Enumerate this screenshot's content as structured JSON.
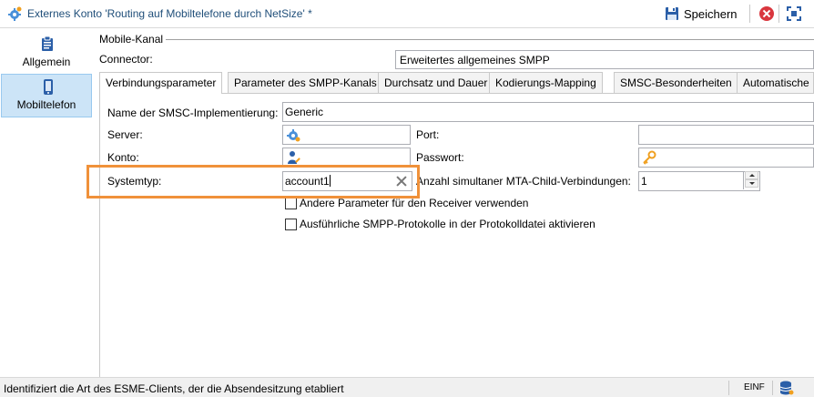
{
  "window": {
    "title": "Externes Konto 'Routing auf Mobiltelefone durch NetSize' *",
    "save_label": "Speichern",
    "icons": [
      "account-gear-icon",
      "save-disk-icon",
      "close-icon",
      "maximize-icon"
    ],
    "accent_color": "#1f4e79"
  },
  "sidebar": {
    "items": [
      {
        "label": "Allgemein",
        "icon": "clipboard-icon",
        "active": false
      },
      {
        "label": "Mobiltelefon",
        "icon": "mobile-phone-icon",
        "active": true
      }
    ]
  },
  "main": {
    "section_label": "Mobile-Kanal",
    "connector_label": "Connector:",
    "connector_value": "Erweitertes allgemeines SMPP",
    "tabs": [
      {
        "label": "Verbindungsparameter",
        "active": true
      },
      {
        "label": "Parameter des SMPP-Kanals",
        "active": false
      },
      {
        "label": "Durchsatz und Dauer",
        "active": false
      },
      {
        "label": "Kodierungs-Mapping",
        "active": false
      },
      {
        "label": "SMSC-Besonderheiten",
        "active": false
      },
      {
        "label": "Automatische",
        "active": false
      }
    ],
    "form": {
      "smsc_label": "Name der SMSC-Implementierung:",
      "smsc_value": "Generic",
      "server_label": "Server:",
      "server_value": "",
      "port_label": "Port:",
      "port_value": "",
      "konto_label": "Konto:",
      "konto_value": "",
      "passwort_label": "Passwort:",
      "passwort_value": "",
      "systemtyp_label": "Systemtyp:",
      "systemtyp_value": "account1",
      "mta_label": "Anzahl simultaner MTA-Child-Verbindungen:",
      "mta_value": "1",
      "checkbox_receiver_label": "Andere Parameter für den Receiver verwenden",
      "checkbox_receiver_checked": false,
      "checkbox_log_label": "Ausführliche SMPP-Protokolle in der Protokolldatei aktivieren",
      "checkbox_log_checked": false
    },
    "highlight_color": "#f0913a"
  },
  "statusbar": {
    "text": "Identifiziert die Art des ESME-Clients, der die Absendesitzung etabliert",
    "mode": "EINF",
    "icon": "database-icon"
  }
}
